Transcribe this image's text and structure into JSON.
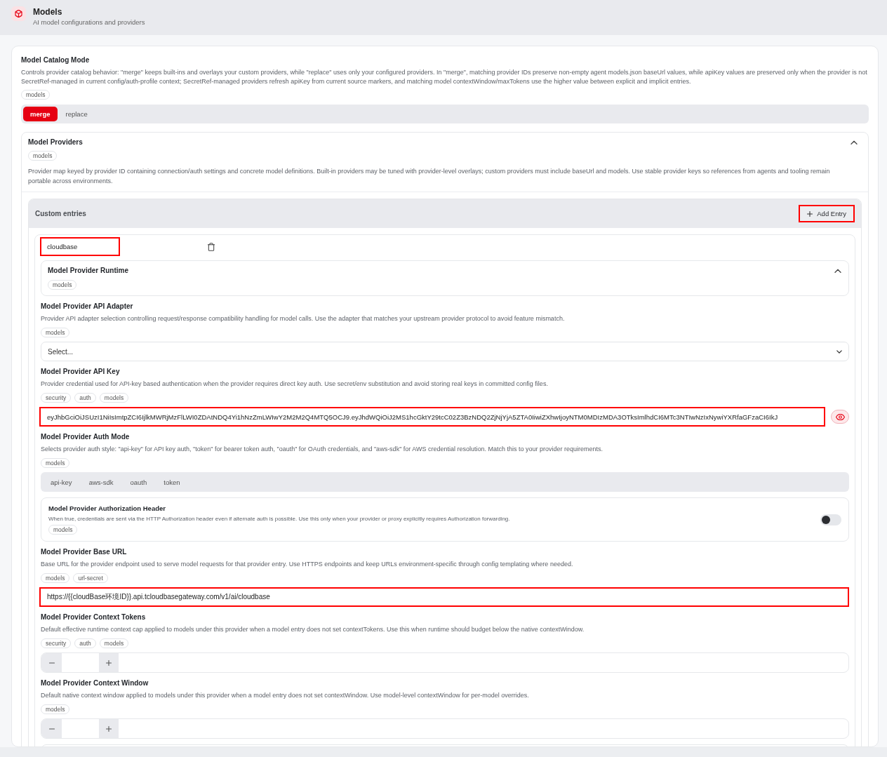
{
  "header": {
    "title": "Models",
    "subtitle": "AI model configurations and providers"
  },
  "catalog_mode": {
    "title": "Model Catalog Mode",
    "description": "Controls provider catalog behavior: \"merge\" keeps built-ins and overlays your custom providers, while \"replace\" uses only your configured providers. In \"merge\", matching provider IDs preserve non-empty agent models.json baseUrl values, while apiKey values are preserved only when the provider is not SecretRef-managed in current config/auth-profile context; SecretRef-managed providers refresh apiKey from current source markers, and matching model contextWindow/maxTokens use the higher value between explicit and implicit entries.",
    "tags": [
      "models"
    ],
    "options": [
      {
        "label": "merge",
        "selected": true
      },
      {
        "label": "replace",
        "selected": false
      }
    ]
  },
  "providers": {
    "title": "Model Providers",
    "expanded": true,
    "tags": [
      "models"
    ],
    "description": "Provider map keyed by provider ID containing connection/auth settings and concrete model definitions. Built-in providers may be tuned with provider-level overlays; custom providers must include baseUrl and models. Use stable provider keys so references from agents and tooling remain portable across environments.",
    "custom_entries": {
      "title": "Custom entries",
      "add_button": {
        "label": "Add Entry",
        "highlighted": true
      },
      "entries": [
        {
          "name": "cloudbase",
          "highlighted": true,
          "fields": [
            {
              "kind": "group",
              "title": "Model Provider Runtime",
              "tags": [
                "models"
              ],
              "expanded": true
            },
            {
              "kind": "select",
              "title": "Model Provider API Adapter",
              "description": "Provider API adapter selection controlling request/response compatibility handling for model calls. Use the adapter that matches your upstream provider protocol to avoid feature mismatch.",
              "tags": [
                "models"
              ],
              "placeholder": "Select..."
            },
            {
              "kind": "secret",
              "title": "Model Provider API Key",
              "description": "Provider credential used for API-key based authentication when the provider requires direct key auth. Use secret/env substitution and avoid storing real keys in committed config files.",
              "tags": [
                "security",
                "auth",
                "models"
              ],
              "value": "eyJhbGciOiJSUzI1NiIsImtpZCI6IjlkMWRjMzFlLWI0ZDAtNDQ4Yi1hNzZmLWIwY2M2M2Q4MTQ5OCJ9.eyJhdWQiOiJ2MS1hcGktY29tcC02Z3BzNDQ2ZjNjYjA5ZTA0IiwiZXhwIjoyNTM0MDIzMDA3OTksImlhdCI6MTc3NTIwNzIxNywiYXRfaGFzaCI6IkJ",
              "highlighted": true
            },
            {
              "kind": "choice",
              "title": "Model Provider Auth Mode",
              "description": "Selects provider auth style: \"api-key\" for API key auth, \"token\" for bearer token auth, \"oauth\" for OAuth credentials, and \"aws-sdk\" for AWS credential resolution. Match this to your provider requirements.",
              "tags": [
                "models"
              ],
              "options": [
                {
                  "label": "api-key",
                  "selected": false
                },
                {
                  "label": "aws-sdk",
                  "selected": false
                },
                {
                  "label": "oauth",
                  "selected": false
                },
                {
                  "label": "token",
                  "selected": false
                }
              ]
            },
            {
              "kind": "toggle",
              "title": "Model Provider Authorization Header",
              "description": "When true, credentials are sent via the HTTP Authorization header even if alternate auth is possible. Use this only when your provider or proxy explicitly requires Authorization forwarding.",
              "tags": [
                "models"
              ],
              "on": false
            },
            {
              "kind": "text",
              "title": "Model Provider Base URL",
              "description": "Base URL for the provider endpoint used to serve model requests for that provider entry. Use HTTPS endpoints and keep URLs environment-specific through config templating where needed.",
              "tags": [
                "models",
                "url-secret"
              ],
              "value": "https://{{cloudBase环境ID}}.api.tcloudbasegateway.com/v1/ai/cloudbase",
              "highlighted": true
            },
            {
              "kind": "number",
              "title": "Model Provider Context Tokens",
              "description": "Default effective runtime context cap applied to models under this provider when a model entry does not set contextTokens. Use this when runtime should budget below the native contextWindow.",
              "tags": [
                "security",
                "auth",
                "models"
              ]
            },
            {
              "kind": "number",
              "title": "Model Provider Context Window",
              "description": "Default native context window applied to models under this provider when a model entry does not set contextWindow. Use model-level contextWindow for per-model overrides.",
              "tags": [
                "models"
              ]
            }
          ]
        }
      ]
    }
  }
}
